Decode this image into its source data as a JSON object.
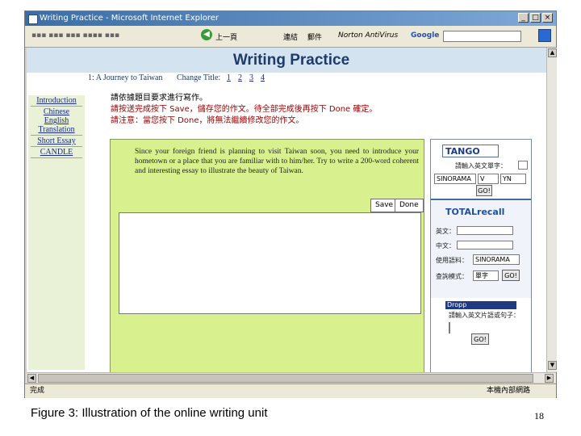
{
  "window": {
    "title": "Writing Practice - Microsoft Internet Explorer",
    "status": "完成",
    "status_zone": "本機內部網路"
  },
  "toolbar": {
    "back_label": "上一頁",
    "links_label": "連結",
    "mail_label": "郵件",
    "norton_label": "Norton AntiVirus",
    "google_label": "Google"
  },
  "page": {
    "title": "Writing Practice",
    "topic": "1: A Journey to Taiwan",
    "change_title_label": "Change Title:",
    "title_numbers": [
      "1",
      "2",
      "3",
      "4"
    ],
    "nav": [
      "Introduction",
      "Chinese English Translation",
      "Short Essay",
      "CANDLE"
    ],
    "instructions": [
      "請依據題目要求進行寫作。",
      "請按送完成按下 Save，儲存您的作文。待全部完成後再按下 Done 確定。",
      "請注意：當您按下 Done，將無法繼續修改您的作文。"
    ],
    "prompt": "Since your foreign friend is planning to visit Taiwan soon, you need to introduce your hometown or a place that you are familiar with to him/her. Try to write a 200-word coherent and interesting essay to illustrate the beauty of Taiwan.",
    "save_label": "Save",
    "done_label": "Done",
    "essay_value": ""
  },
  "tools": {
    "tango_logo": "TANGO",
    "tango_label": "請輸入英文單字：",
    "tango_source": "SINORAMA",
    "tango_opt1": "V",
    "tango_opt2": "YN",
    "go_label": "GO!",
    "totalrecall_logo": "TOTALrecall",
    "english_label": "英文：",
    "chinese_label": "中文：",
    "corpus_label": "使用語料：",
    "corpus_value": "SINORAMA",
    "search_label": "查詢模式：",
    "search_value": "單字",
    "drops_logo": "Dropp",
    "drops_label": "請輸入英文片語或句子：",
    "go2_label": "GO!"
  },
  "caption": "Figure 3: Illustration of the online writing unit",
  "page_number": "18"
}
